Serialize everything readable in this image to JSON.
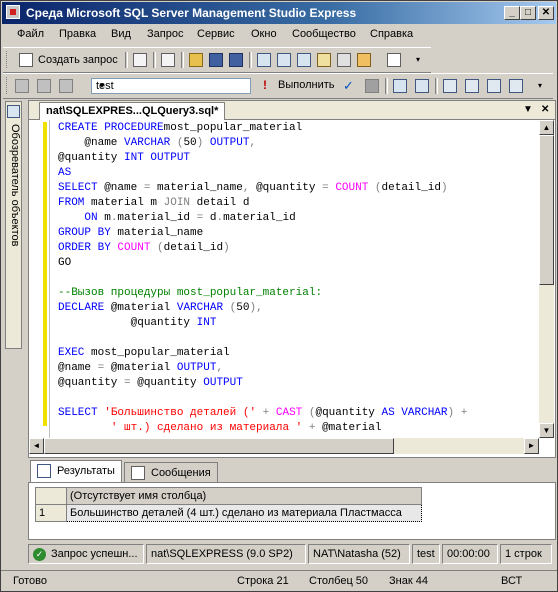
{
  "window": {
    "title": "Среда Microsoft SQL Server Management Studio Express"
  },
  "menu": [
    "Файл",
    "Правка",
    "Вид",
    "Запрос",
    "Сервис",
    "Окно",
    "Сообщество",
    "Справка"
  ],
  "toolbar1": {
    "new_query_label": "Создать запрос"
  },
  "toolbar2": {
    "database": "test",
    "execute_label": "Выполнить"
  },
  "sidebar": {
    "object_explorer_label": "Обозреватель объектов"
  },
  "document": {
    "tab_title": "nat\\SQLEXPRES...QLQuery3.sql*"
  },
  "code_lines": [
    [
      [
        "kw",
        "CREATE PROCEDURE"
      ],
      [
        "",
        "most_popular_material"
      ]
    ],
    [
      [
        "",
        "    @name "
      ],
      [
        "kw",
        "VARCHAR"
      ],
      [
        "gr",
        " ("
      ],
      [
        "",
        "50"
      ],
      [
        "gr",
        ") "
      ],
      [
        "kw",
        "OUTPUT"
      ],
      [
        "gr",
        ","
      ]
    ],
    [
      [
        "",
        "@quantity "
      ],
      [
        "kw",
        "INT OUTPUT"
      ]
    ],
    [
      [
        "kw",
        "AS"
      ]
    ],
    [
      [
        "kw",
        "SELECT"
      ],
      [
        "",
        "",
        " @name "
      ],
      [
        "gr",
        "="
      ],
      [
        "",
        " material_name"
      ],
      [
        "gr",
        ","
      ],
      [
        "",
        " @quantity "
      ],
      [
        "gr",
        "="
      ],
      [
        "",
        " "
      ],
      [
        "fn",
        "COUNT"
      ],
      [
        "gr",
        " ("
      ],
      [
        "",
        "detail_id"
      ],
      [
        "gr",
        ")"
      ]
    ],
    [
      [
        "kw",
        "FROM"
      ],
      [
        "",
        " material m "
      ],
      [
        "gr",
        "JOIN"
      ],
      [
        "",
        " detail d"
      ]
    ],
    [
      [
        "kw",
        "    ON"
      ],
      [
        "",
        " m"
      ],
      [
        "gr",
        "."
      ],
      [
        "",
        "material_id "
      ],
      [
        "gr",
        "="
      ],
      [
        "",
        " d"
      ],
      [
        "gr",
        "."
      ],
      [
        "",
        "material_id"
      ]
    ],
    [
      [
        "kw",
        "GROUP BY"
      ],
      [
        "",
        " material_name"
      ]
    ],
    [
      [
        "kw",
        "ORDER BY"
      ],
      [
        "",
        " "
      ],
      [
        "fn",
        "COUNT"
      ],
      [
        "gr",
        " ("
      ],
      [
        "",
        "detail_id"
      ],
      [
        "gr",
        ")"
      ]
    ],
    [
      [
        "",
        "GO"
      ]
    ],
    [
      [
        "",
        ""
      ]
    ],
    [
      [
        "cm",
        "--Вызов процедуры most_popular_material:"
      ]
    ],
    [
      [
        "kw",
        "DECLARE"
      ],
      [
        "",
        " @material "
      ],
      [
        "kw",
        "VARCHAR"
      ],
      [
        "gr",
        " ("
      ],
      [
        "",
        "50"
      ],
      [
        "gr",
        "),"
      ]
    ],
    [
      [
        "",
        "           @quantity "
      ],
      [
        "kw",
        "INT"
      ]
    ],
    [
      [
        "",
        ""
      ]
    ],
    [
      [
        "kw",
        "EXEC"
      ],
      [
        "",
        " most_popular_material"
      ]
    ],
    [
      [
        "",
        "@name "
      ],
      [
        "gr",
        "="
      ],
      [
        "",
        " @material "
      ],
      [
        "kw",
        "OUTPUT"
      ],
      [
        "gr",
        ","
      ]
    ],
    [
      [
        "",
        "@quantity "
      ],
      [
        "gr",
        "="
      ],
      [
        "",
        " @quantity "
      ],
      [
        "kw",
        "OUTPUT"
      ]
    ],
    [
      [
        "",
        ""
      ]
    ],
    [
      [
        "kw",
        "SELECT"
      ],
      [
        "",
        " "
      ],
      [
        "str",
        "'Большинство деталей ('"
      ],
      [
        "",
        " "
      ],
      [
        "gr",
        "+"
      ],
      [
        "",
        " "
      ],
      [
        "fn",
        "CAST"
      ],
      [
        "gr",
        " ("
      ],
      [
        "",
        "@quantity "
      ],
      [
        "kw",
        "AS VARCHAR"
      ],
      [
        "gr",
        ")"
      ],
      [
        "",
        " "
      ],
      [
        "gr",
        "+"
      ]
    ],
    [
      [
        "",
        "        "
      ],
      [
        "str",
        "' шт.) сделано из материала '"
      ],
      [
        "",
        " "
      ],
      [
        "gr",
        "+"
      ],
      [
        "",
        " @material"
      ]
    ]
  ],
  "results": {
    "tab_results": "Результаты",
    "tab_messages": "Сообщения",
    "column_header": "(Отсутствует имя столбца)",
    "row_number": "1",
    "row_value": "Большинство деталей (4 шт.) сделано из материала Пластмасса"
  },
  "query_status": {
    "message": "Запрос  успешн...",
    "server": "nat\\SQLEXPRESS (9.0 SP2)",
    "user": "NAT\\Natasha (52)",
    "database": "test",
    "time": "00:00:00",
    "rows": "1 строк"
  },
  "statusbar": {
    "ready": "Готово",
    "line": "Строка 21",
    "column": "Столбец 50",
    "char": "Знак 44",
    "mode": "ВСТ"
  },
  "colors": {
    "keyword": "#0000ff",
    "function": "#ff00ff",
    "string": "#ff0000",
    "comment": "#008000",
    "title_start": "#0a246a",
    "title_end": "#a6caf0"
  }
}
